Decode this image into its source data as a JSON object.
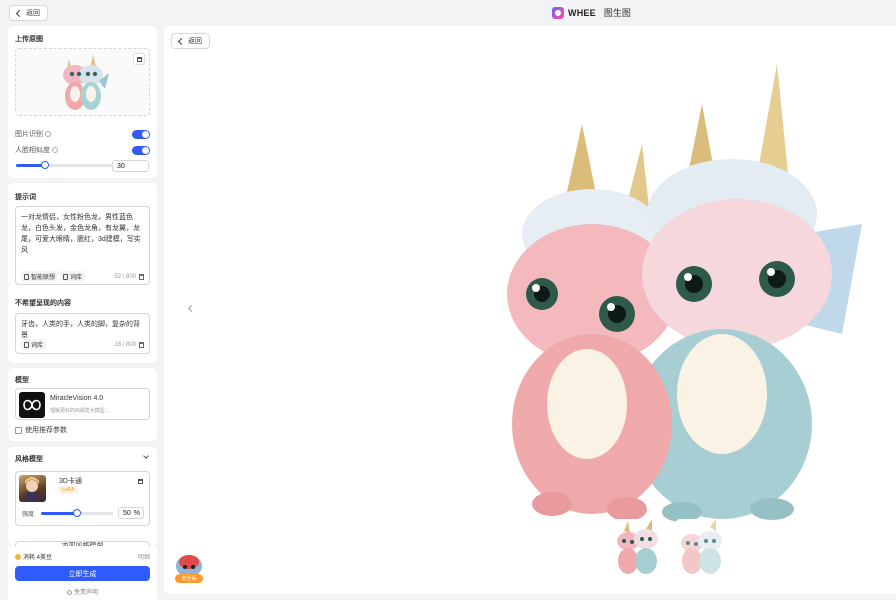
{
  "header": {
    "back_label": "返回",
    "brand_name": "WHEE",
    "page_title": "图生图"
  },
  "upload": {
    "title": "上传原图",
    "image_recognition_label": "图片识别",
    "face_similarity_label": "人脸相似度",
    "face_similarity_value": "30",
    "face_similarity_fraction": 0.3
  },
  "prompt": {
    "title": "提示词",
    "text": "一对龙情侣，女性粉色龙，男性蓝色龙，白色头发，金色龙角，有龙翼，龙尾，可爱大眼睛，腮红，3d建模，写实风",
    "smart_assoc_label": "智能联想",
    "lexicon_label": "词库",
    "counter": "52 / 800"
  },
  "negative": {
    "title": "不希望呈现的内容",
    "text": "牙齿，人类的手，人类的脚，复杂的背景",
    "lexicon_label": "词库",
    "counter": "18 / 800"
  },
  "model": {
    "title": "模型",
    "name": "MiracleVision 4.0",
    "desc": "理解更好的AI视觉大模型...",
    "recommend_label": "使用推荐参数"
  },
  "style_model": {
    "title": "风格模型",
    "name": "3D卡通",
    "badge": "LoRA",
    "strength_label": "强度",
    "strength_value": "50",
    "strength_unit": "%",
    "strength_fraction": 0.5,
    "add_label": "添加风格模型"
  },
  "footer": {
    "cost": "消耗 4美豆",
    "detail": "明细",
    "generate_label": "立即生成",
    "disclaimer": "免责声明"
  },
  "main": {
    "back_label": "返回",
    "avatar_badge": "安全看"
  }
}
